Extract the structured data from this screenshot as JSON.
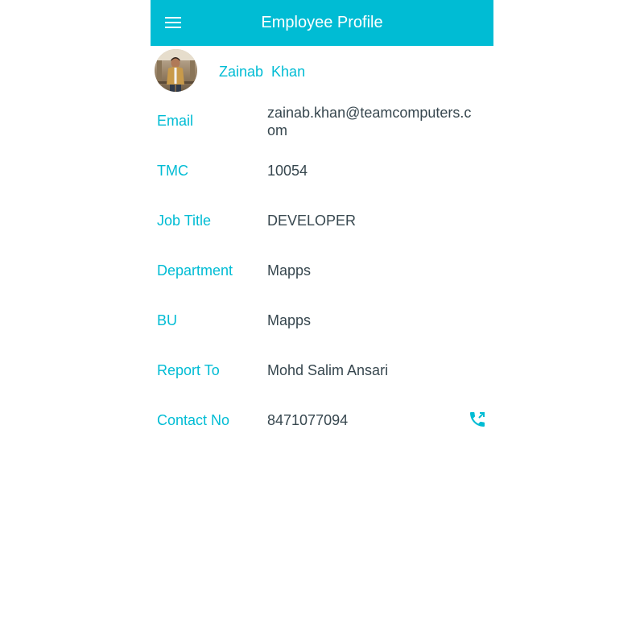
{
  "app_bar": {
    "title": "Employee Profile",
    "menu_icon": "menu-icon",
    "color": "#00bcd4"
  },
  "profile": {
    "name": "Zainab  Khan",
    "avatar_icon": "avatar"
  },
  "fields": [
    {
      "label": "Email",
      "value": "zainab.khan@teamcomputers.com"
    },
    {
      "label": "TMC",
      "value": "10054"
    },
    {
      "label": "Job Title",
      "value": "DEVELOPER"
    },
    {
      "label": "Department",
      "value": "Mapps"
    },
    {
      "label": "BU",
      "value": "Mapps"
    },
    {
      "label": "Report To",
      "value": "Mohd Salim Ansari"
    },
    {
      "label": "Contact No",
      "value": "8471077094",
      "action_icon": "phone-call-icon"
    }
  ],
  "colors": {
    "accent": "#00bcd4",
    "value_text": "#37474f",
    "background": "#ffffff"
  }
}
